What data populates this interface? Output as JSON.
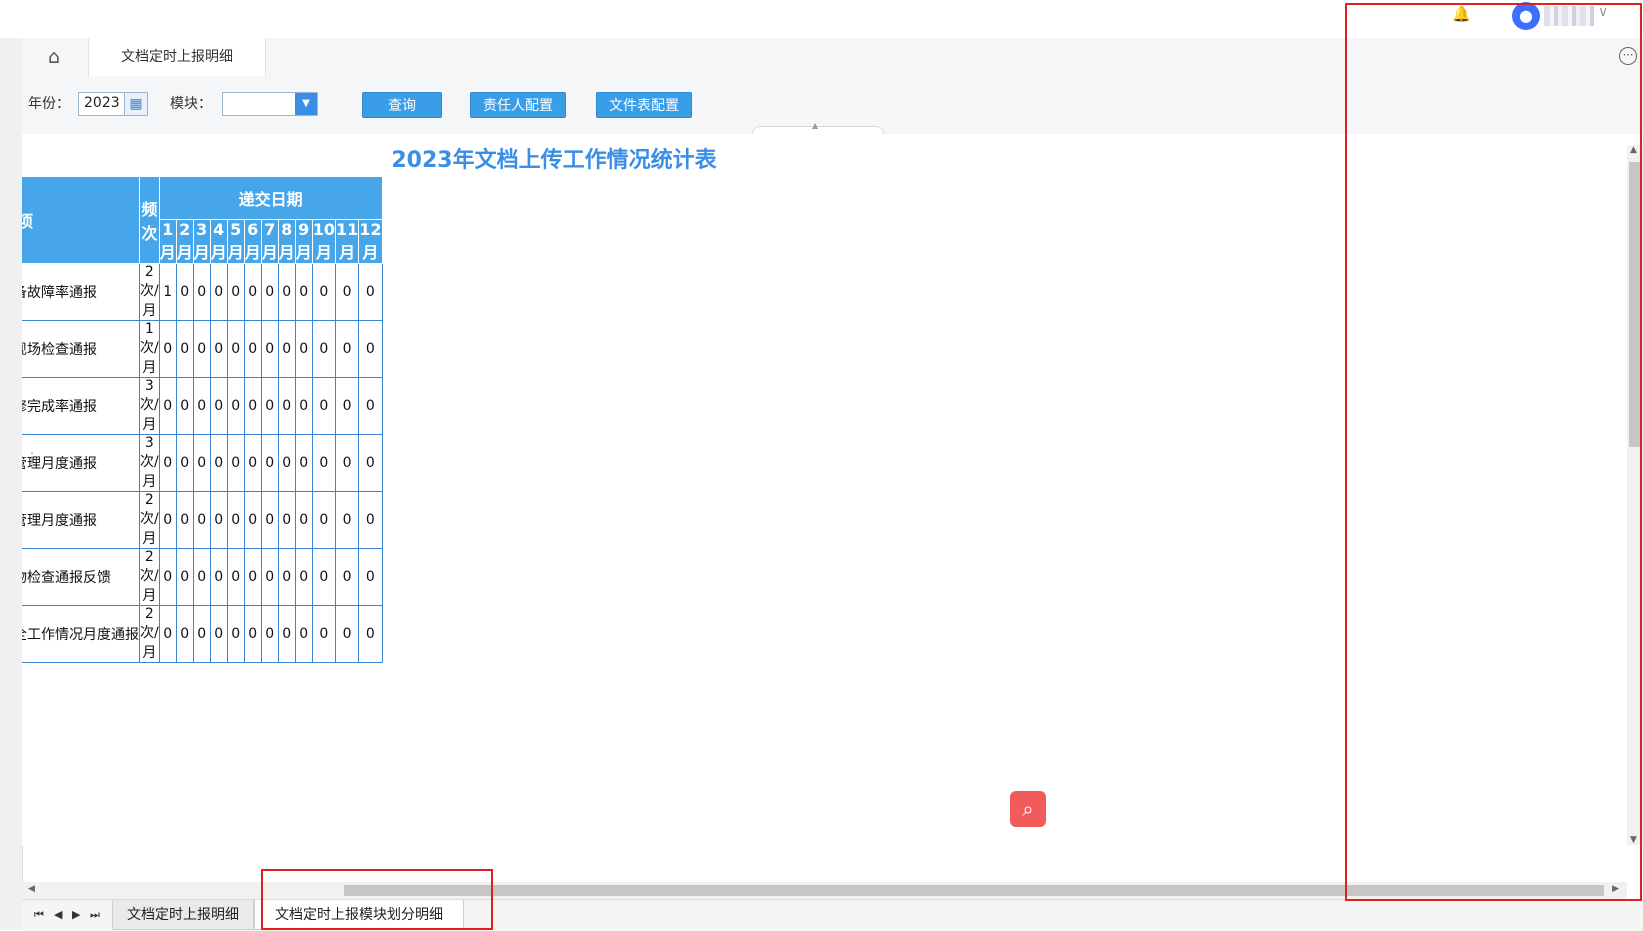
{
  "header": {
    "bell_icon": "bell-icon",
    "avatar_icon": "user-icon"
  },
  "tabs": {
    "home_icon": "home-icon",
    "active_tab": "文档定时上报明细",
    "more_icon": "more-icon"
  },
  "filters": {
    "year_label": "年份：",
    "year_value": "2023",
    "module_label": "模块：",
    "module_value": "",
    "query_button": "查询",
    "owner_config_button": "责任人配置",
    "filetable_config_button": "文件表配置"
  },
  "report": {
    "title": "2023年文档上传工作情况统计表",
    "col_item": "事项",
    "col_freq": "频次",
    "col_group": "递交日期",
    "months": [
      "1月",
      "2月",
      "3月",
      "4月",
      "5月",
      "6月",
      "7月",
      "8月",
      "9月",
      "10月",
      "11月",
      "12月"
    ],
    "rows": [
      {
        "item": "设备故障率通报",
        "freq": "2次/月",
        "values": [
          "1",
          "0",
          "0",
          "0",
          "0",
          "0",
          "0",
          "0",
          "0",
          "0",
          "0",
          "0"
        ]
      },
      {
        "item": "班现场检查通报",
        "freq": "1次/月",
        "values": [
          "0",
          "0",
          "0",
          "0",
          "0",
          "0",
          "0",
          "0",
          "0",
          "0",
          "0",
          "0"
        ]
      },
      {
        "item": "检修完成率通报",
        "freq": "3次/月",
        "values": [
          "0",
          "0",
          "0",
          "0",
          "0",
          "0",
          "0",
          "0",
          "0",
          "0",
          "0",
          "0"
        ]
      },
      {
        "item": "件管理月度通报",
        "freq": "3次/月",
        "values": [
          "0",
          "0",
          "0",
          "0",
          "0",
          "0",
          "0",
          "0",
          "0",
          "0",
          "0",
          "0"
        ]
      },
      {
        "item": "件管理月度通报",
        "freq": "2次/月",
        "values": [
          "0",
          "0",
          "0",
          "0",
          "0",
          "0",
          "0",
          "0",
          "0",
          "0",
          "0",
          "0"
        ]
      },
      {
        "item": "异物检查通报反馈",
        "freq": "2次/月",
        "values": [
          "0",
          "0",
          "0",
          "0",
          "0",
          "0",
          "0",
          "0",
          "0",
          "0",
          "0",
          "0"
        ]
      },
      {
        "item": "安全工作情况月度通报",
        "freq": "2次/月",
        "values": [
          "0",
          "0",
          "0",
          "0",
          "0",
          "0",
          "0",
          "0",
          "0",
          "0",
          "0",
          "0"
        ]
      }
    ]
  },
  "sheets": {
    "tab1": "文档定时上报明细",
    "tab2": "文档定时上报模块划分明细"
  },
  "colors": {
    "accent": "#3a8ee6",
    "header_fill": "#47a6ea",
    "highlight": "#e02020",
    "search_fab": "#f25b5b"
  }
}
